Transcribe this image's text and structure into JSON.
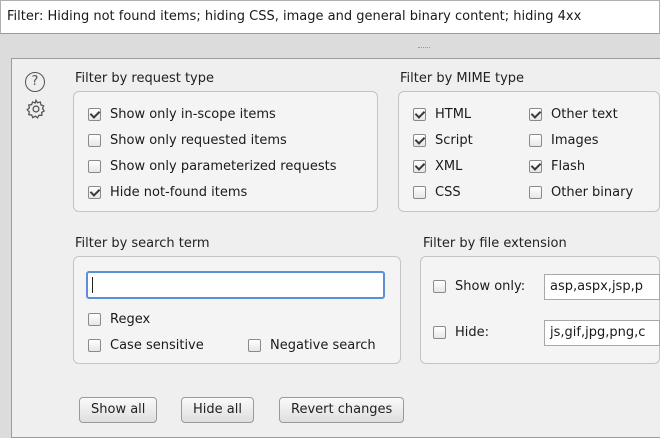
{
  "filter_summary": "Filter: Hiding not found items;  hiding CSS, image and general binary content;  hiding 4xx",
  "icons": {
    "help": "help-icon",
    "settings": "gear-icon"
  },
  "request_type": {
    "title": "Filter by request type",
    "options": [
      {
        "label": "Show only in-scope items",
        "checked": true
      },
      {
        "label": "Show only requested items",
        "checked": false
      },
      {
        "label": "Show only parameterized requests",
        "checked": false
      },
      {
        "label": "Hide not-found items",
        "checked": true
      }
    ]
  },
  "mime_type": {
    "title": "Filter by MIME type",
    "options": [
      {
        "label": "HTML",
        "checked": true
      },
      {
        "label": "Script",
        "checked": true
      },
      {
        "label": "XML",
        "checked": true
      },
      {
        "label": "CSS",
        "checked": false
      },
      {
        "label": "Other text",
        "checked": true
      },
      {
        "label": "Images",
        "checked": false
      },
      {
        "label": "Flash",
        "checked": true
      },
      {
        "label": "Other binary",
        "checked": false
      }
    ]
  },
  "search_term": {
    "title": "Filter by search term",
    "value": "",
    "regex": {
      "label": "Regex",
      "checked": false
    },
    "case_sensitive": {
      "label": "Case sensitive",
      "checked": false
    },
    "negative": {
      "label": "Negative search",
      "checked": false
    }
  },
  "file_extension": {
    "title": "Filter by file extension",
    "show_only": {
      "label": "Show only:",
      "checked": false,
      "value": "asp,aspx,jsp,p"
    },
    "hide": {
      "label": "Hide:",
      "checked": false,
      "value": "js,gif,jpg,png,c"
    }
  },
  "buttons": {
    "show_all": "Show all",
    "hide_all": "Hide all",
    "revert": "Revert changes"
  },
  "colors": {
    "focus_border": "#5b8fd6",
    "panel_bg": "#efefef"
  }
}
